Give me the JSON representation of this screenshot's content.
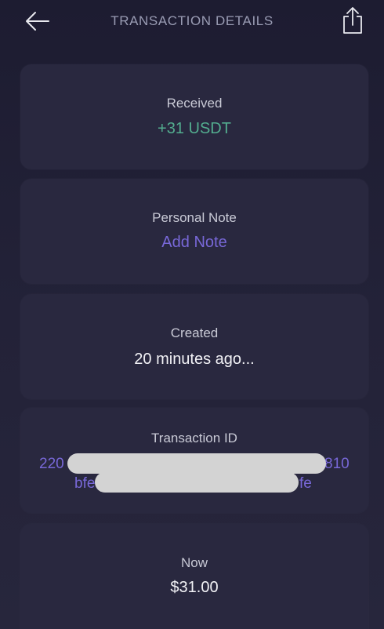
{
  "header": {
    "title": "TRANSACTION DETAILS",
    "back_icon": "arrow-left-icon",
    "share_icon": "share-icon"
  },
  "received": {
    "label": "Received",
    "amount": "+31 USDT"
  },
  "note": {
    "label": "Personal Note",
    "action": "Add Note"
  },
  "created": {
    "label": "Created",
    "value": "20 minutes ago..."
  },
  "transaction": {
    "label": "Transaction ID",
    "id_line1_start": "220",
    "id_line1_end": "810",
    "id_line2_start": "bfe",
    "id_line2_end": "fe"
  },
  "now": {
    "label": "Now",
    "value": "$31.00"
  },
  "colors": {
    "background": "#1d1c31",
    "card": "#29283f",
    "accent_green": "#53ad8f",
    "accent_purple": "#7868d8"
  }
}
